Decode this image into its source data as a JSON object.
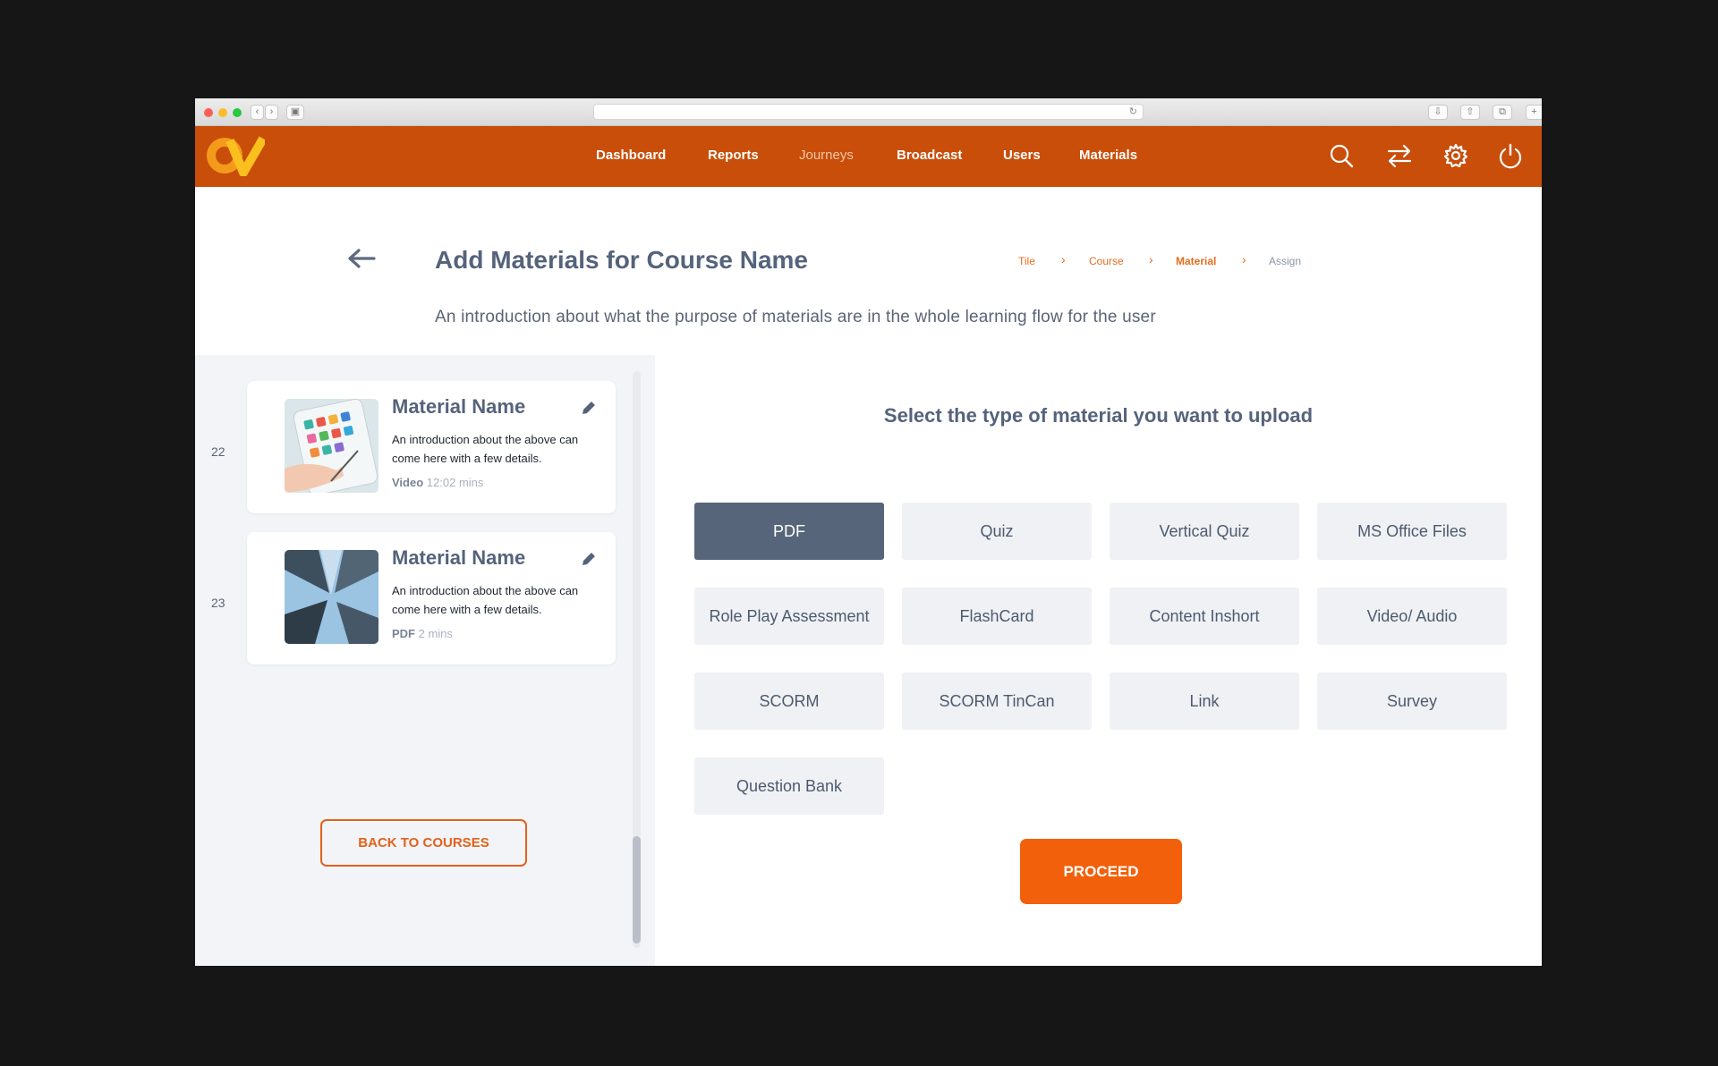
{
  "nav": {
    "items": [
      {
        "label": "Dashboard"
      },
      {
        "label": "Reports"
      },
      {
        "label": "Journeys"
      },
      {
        "label": "Broadcast"
      },
      {
        "label": "Users"
      },
      {
        "label": "Materials"
      }
    ],
    "icons": [
      "search-icon",
      "swap-icon",
      "gear-icon",
      "power-icon"
    ],
    "color": "#c84e0a"
  },
  "header": {
    "title": "Add Materials for Course Name",
    "intro": "An introduction about what the purpose of materials are in the whole learning flow for the user",
    "breadcrumb": [
      "Tile",
      "Course",
      "Material",
      "Assign"
    ]
  },
  "materials": [
    {
      "index": "22",
      "name": "Material Name",
      "description": "An introduction about the above can come here with a few details.",
      "type": "Video",
      "duration": "12:02 mins"
    },
    {
      "index": "23",
      "name": "Material Name",
      "description": "An introduction about the above can come here with a few details.",
      "type": "PDF",
      "duration": "2 mins"
    }
  ],
  "sidebar": {
    "back_label": "BACK TO COURSES"
  },
  "upload": {
    "heading": "Select the type of material you want to upload",
    "types": [
      {
        "label": "PDF",
        "selected": true
      },
      {
        "label": "Quiz"
      },
      {
        "label": "Vertical Quiz"
      },
      {
        "label": "MS Office Files"
      },
      {
        "label": "Role Play Assessment"
      },
      {
        "label": "FlashCard"
      },
      {
        "label": "Content Inshort"
      },
      {
        "label": "Video/ Audio"
      },
      {
        "label": "SCORM"
      },
      {
        "label": "SCORM TinCan"
      },
      {
        "label": "Link"
      },
      {
        "label": "Survey"
      },
      {
        "label": "Question Bank"
      }
    ],
    "proceed_label": "PROCEED"
  },
  "colors": {
    "accent": "#f2600b",
    "selected": "#566579",
    "text": "#55637b"
  }
}
